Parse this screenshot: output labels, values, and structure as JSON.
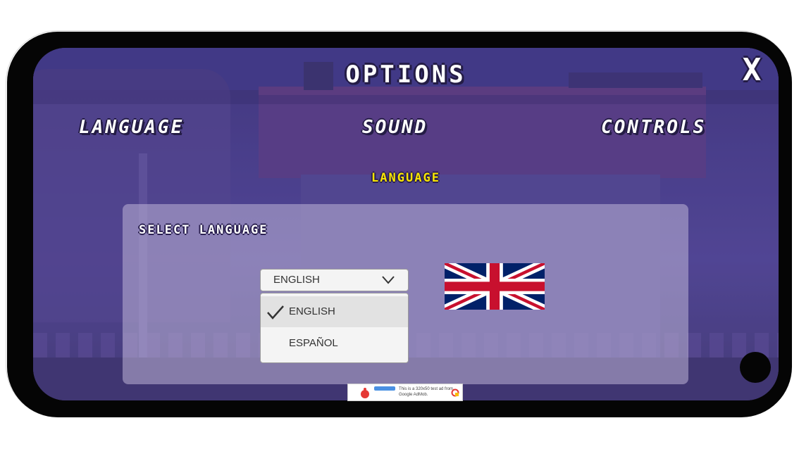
{
  "screen": {
    "title": "OPTIONS",
    "close_label": "X",
    "tabs": [
      {
        "label": "LANGUAGE"
      },
      {
        "label": "SOUND"
      },
      {
        "label": "CONTROLS"
      }
    ],
    "section_heading": "LANGUAGE",
    "panel": {
      "label": "SELECT LANGUAGE",
      "dropdown": {
        "selected": "ENGLISH",
        "options": [
          {
            "label": "ENGLISH",
            "checked": true
          },
          {
            "label": "ESPAÑOL",
            "checked": false
          }
        ]
      },
      "flag_icon": "uk-flag-icon"
    },
    "ad_banner": {
      "text": "This is a 320x50 test ad from Google AdMob."
    }
  },
  "colors": {
    "heading_yellow": "#f7e400",
    "text_white": "#ffffff",
    "outline_dark": "#241c45"
  }
}
